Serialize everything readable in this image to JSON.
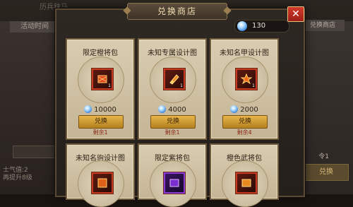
{
  "background": {
    "window_title": "历兵秣马",
    "left_tab": "活动时间",
    "right_tab": "兑换商店",
    "left_text": [
      "士气值:2",
      "再提升8级"
    ],
    "right_button": "兑换",
    "right_small": "令1"
  },
  "shop": {
    "title": "兑换商店",
    "close_label": "✕",
    "currency": {
      "icon": "blue-gem-icon",
      "value": "130"
    },
    "items": [
      {
        "name": "限定橙将包",
        "price": "10000",
        "button": "兑换",
        "remain": "剩余1",
        "qty": "1",
        "icon": "orange-pack-icon"
      },
      {
        "name": "未知专属设计图",
        "price": "4000",
        "button": "兑换",
        "remain": "剩余1",
        "qty": "1",
        "icon": "orange-scroll-icon"
      },
      {
        "name": "未知名甲设计图",
        "price": "2000",
        "button": "兑换",
        "remain": "剩余4",
        "qty": "1",
        "icon": "orange-armor-blueprint-icon"
      },
      {
        "name": "未知名驹设计图",
        "icon": "orange-blueprint-icon"
      },
      {
        "name": "限定紫将包",
        "icon": "purple-pack-icon"
      },
      {
        "name": "橙色武将包",
        "icon": "orange-general-pack-icon"
      }
    ]
  },
  "colors": {
    "accent_gold": "#e8b64a",
    "card_bg": "#d9ccb0",
    "close_red": "#c53a20",
    "gem_blue": "#2d78d8"
  }
}
